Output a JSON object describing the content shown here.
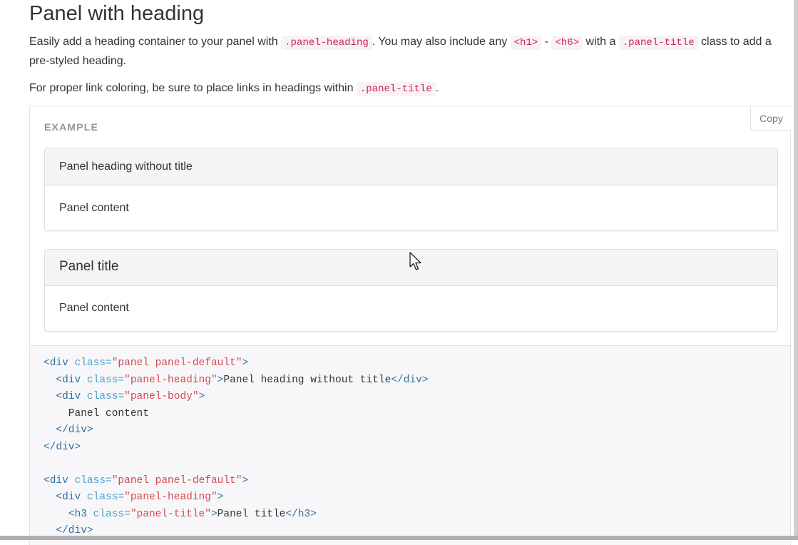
{
  "section": {
    "title": "Panel with heading",
    "para1": {
      "t1": "Easily add a heading container to your panel with ",
      "c1": ".panel-heading",
      "t2": ". You may also include any ",
      "c2": "<h1>",
      "t3": " - ",
      "c3": "<h6>",
      "t4": " with a ",
      "c4": ".panel-title",
      "t5": " class to add a pre-styled heading."
    },
    "para2": {
      "t1": "For proper link coloring, be sure to place links in headings within ",
      "c1": ".panel-title",
      "t2": "."
    }
  },
  "example": {
    "label": "Example",
    "copy_label": "Copy",
    "panel1": {
      "heading": "Panel heading without title",
      "body": "Panel content"
    },
    "panel2": {
      "title": "Panel title",
      "body": "Panel content"
    }
  },
  "code": {
    "lines": [
      [
        [
          "t",
          "<div "
        ],
        [
          "a",
          "class="
        ],
        [
          "s",
          "\"panel panel-default\""
        ],
        [
          "t",
          ">"
        ]
      ],
      [
        [
          "p",
          "  "
        ],
        [
          "t",
          "<div "
        ],
        [
          "a",
          "class="
        ],
        [
          "s",
          "\"panel-heading\""
        ],
        [
          "t",
          ">"
        ],
        [
          "p",
          "Panel heading without title"
        ],
        [
          "t",
          "</div>"
        ]
      ],
      [
        [
          "p",
          "  "
        ],
        [
          "t",
          "<div "
        ],
        [
          "a",
          "class="
        ],
        [
          "s",
          "\"panel-body\""
        ],
        [
          "t",
          ">"
        ]
      ],
      [
        [
          "p",
          "    Panel content"
        ]
      ],
      [
        [
          "p",
          "  "
        ],
        [
          "t",
          "</div>"
        ]
      ],
      [
        [
          "t",
          "</div>"
        ]
      ],
      [],
      [
        [
          "t",
          "<div "
        ],
        [
          "a",
          "class="
        ],
        [
          "s",
          "\"panel panel-default\""
        ],
        [
          "t",
          ">"
        ]
      ],
      [
        [
          "p",
          "  "
        ],
        [
          "t",
          "<div "
        ],
        [
          "a",
          "class="
        ],
        [
          "s",
          "\"panel-heading\""
        ],
        [
          "t",
          ">"
        ]
      ],
      [
        [
          "p",
          "    "
        ],
        [
          "t",
          "<h3 "
        ],
        [
          "a",
          "class="
        ],
        [
          "s",
          "\"panel-title\""
        ],
        [
          "t",
          ">"
        ],
        [
          "p",
          "Panel title"
        ],
        [
          "t",
          "</h3>"
        ]
      ],
      [
        [
          "p",
          "  "
        ],
        [
          "t",
          "</div>"
        ]
      ]
    ]
  },
  "colors": {
    "code_tag": "#2f6f9f",
    "code_attr": "#4f9fcf",
    "code_string": "#d44950",
    "inline_code": "#c7254e"
  }
}
